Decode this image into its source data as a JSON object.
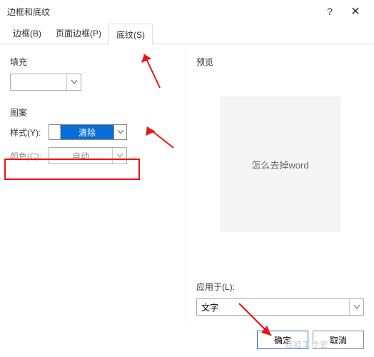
{
  "window": {
    "title": "边框和底纹",
    "help_icon": "?",
    "close_icon": "✕"
  },
  "tabs": {
    "border": "边框(B)",
    "page_border": "页面边框(P)",
    "shading": "底纹(S)"
  },
  "left": {
    "fill_label": "填充",
    "pattern_label": "图案",
    "style_label": "样式(Y):",
    "style_value": "清除",
    "color_label": "颜色(C):",
    "color_value": "自动"
  },
  "right": {
    "preview_label": "预览",
    "preview_text": "怎么去掉word",
    "apply_label": "应用于(L):",
    "apply_value": "文字"
  },
  "footer": {
    "ok": "确定",
    "cancel": "取消"
  },
  "watermark": "娃娃工作室"
}
